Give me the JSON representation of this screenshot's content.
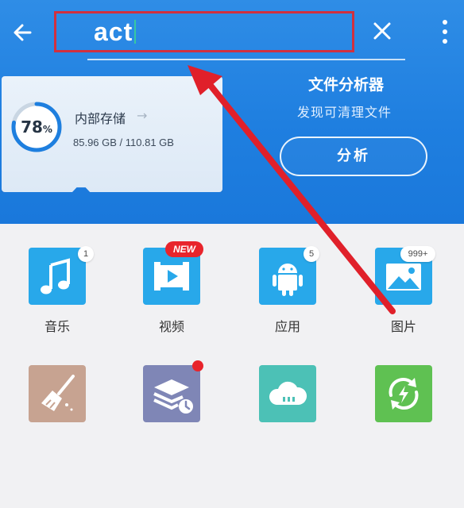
{
  "toolbar": {
    "search_value": "act",
    "back_icon": "back-arrow-icon",
    "clear_icon": "close-icon",
    "more_icon": "more-vertical-icon"
  },
  "storage": {
    "percent": "78",
    "percent_unit": "%",
    "percent_value": 0.78,
    "title": "内部存储",
    "size": "85.96 GB / 110.81 GB"
  },
  "analyzer": {
    "title": "文件分析器",
    "subtitle": "发现可清理文件",
    "button_label": "分析"
  },
  "apps": [
    {
      "label": "音乐",
      "badge": "1",
      "icon": "music-note-icon"
    },
    {
      "label": "视频",
      "badge": "NEW",
      "icon": "video-icon"
    },
    {
      "label": "应用",
      "badge": "5",
      "icon": "android-icon"
    },
    {
      "label": "图片",
      "badge": "999+",
      "icon": "image-icon"
    },
    {
      "label": "",
      "icon": "broom-icon"
    },
    {
      "label": "",
      "icon": "layers-clock-icon"
    },
    {
      "label": "",
      "icon": "cloud-icon"
    },
    {
      "label": "",
      "icon": "sync-icon"
    }
  ],
  "colors": {
    "header_blue": "#1f80e0",
    "highlight_red": "#d1303f",
    "new_badge": "#e8242b",
    "app_blue": "#28a8ea"
  }
}
